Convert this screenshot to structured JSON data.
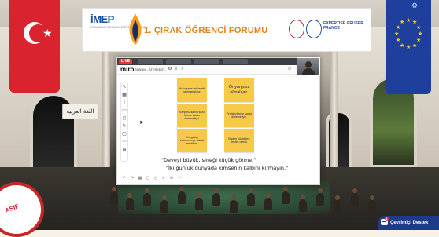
{
  "banner": {
    "org": "İMEP",
    "org_sub": "İSTANBUL MESLEKİ EĞİTİM PROJESİ",
    "title": "1. ÇIRAK ÖĞRENCİ FORUMU",
    "partner_1": "EXPERTISE FRANCE",
    "partner_2": "ERUSER"
  },
  "stream": {
    "live_label": "LIVE",
    "app_name": "miro",
    "board_name": "SUNUM - ATEŞEBİT...",
    "participant_name": "A.T.YELPAZE"
  },
  "board": {
    "stickies": [
      {
        "text": "Hızlır şeye tek taraflı bakmamalıyız."
      },
      {
        "text": "Önyargısız olmalıyız."
      },
      {
        "text": "Karşımızdakini sözü bitene kadar dinlemeliyiz."
      },
      {
        "text": "Problemleriçe kadar dinlemeliyiz."
      },
      {
        "text": "Duygulan incitmemeye dikkat etmeliyiz."
      },
      {
        "text": "Bizden küçüklere destek olmak."
      }
    ],
    "quote_1": "\"Deveyi büyük, sineği küçük görme.\"",
    "quote_2": "\"İki günlük dünyada kimsenin kalbini kırmayın.\""
  },
  "hall": {
    "arabic_sign": "اللغة العربية"
  },
  "stamp": {
    "text": "ASIF"
  },
  "support": {
    "label": "Çevrimiçi Destek",
    "badge": "1"
  },
  "icons": {
    "settings": "gear-icon",
    "chat": "chat-icon",
    "cursor": "cursor-icon"
  },
  "colors": {
    "flag_tr": "#d9232e",
    "flag_eu": "#1f3f9c",
    "sticky": "#f7c948",
    "forum_title": "#e0821c",
    "support": "#1e3a8a",
    "live": "#e53935"
  }
}
